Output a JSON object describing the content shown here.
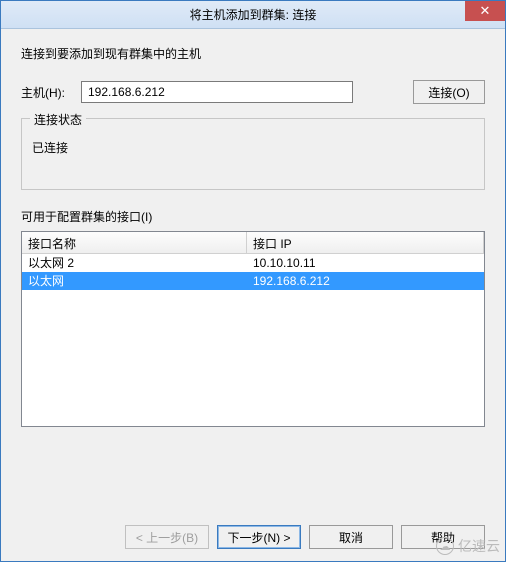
{
  "title": "将主机添加到群集: 连接",
  "instruction": "连接到要添加到现有群集中的主机",
  "host": {
    "label": "主机(H):",
    "value": "192.168.6.212",
    "connect_label": "连接(O)"
  },
  "status_group": {
    "title": "连接状态",
    "status": "已连接"
  },
  "interfaces": {
    "label": "可用于配置群集的接口(I)",
    "columns": {
      "name": "接口名称",
      "ip": "接口 IP"
    },
    "rows": [
      {
        "name": "以太网 2",
        "ip": "10.10.10.11",
        "selected": false
      },
      {
        "name": "以太网",
        "ip": "192.168.6.212",
        "selected": true
      }
    ]
  },
  "buttons": {
    "back": "< 上一步(B)",
    "next": "下一步(N) >",
    "cancel": "取消",
    "help": "帮助"
  },
  "watermark": "亿速云",
  "close_glyph": "✕"
}
